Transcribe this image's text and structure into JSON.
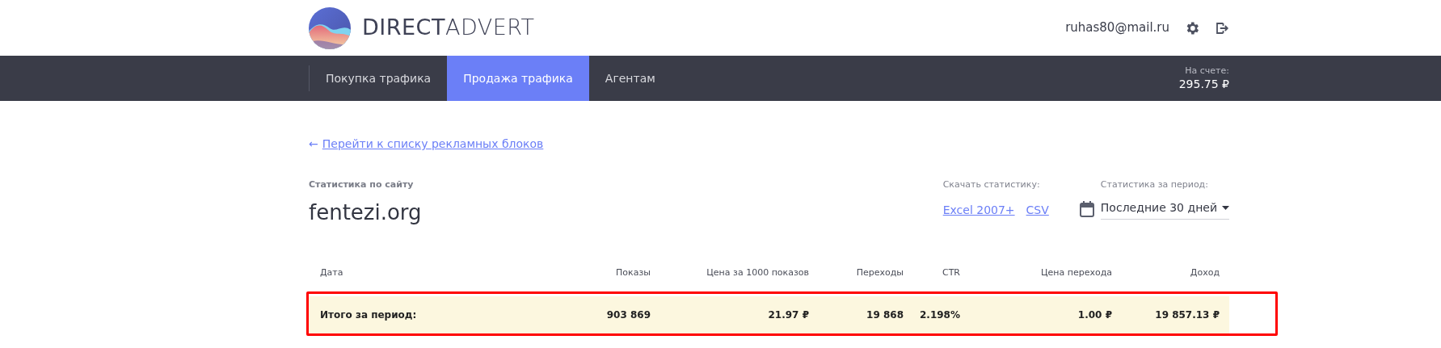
{
  "header": {
    "logo_text": "**DIRECT**ADVERT",
    "user_email": "ruhas80@mail.ru"
  },
  "nav": {
    "tabs": [
      {
        "label": "Покупка трафика",
        "selected": false
      },
      {
        "label": "Продажа трафика",
        "selected": true
      },
      {
        "label": "Агентам",
        "selected": false
      }
    ],
    "balance": {
      "label": "На счете:",
      "value": "295.75 ₽"
    }
  },
  "back_link": {
    "arrow": "←",
    "label": "Перейти к списку рекламных блоков"
  },
  "site": {
    "caption": "Статистика по сайту",
    "name": "fentezi.org"
  },
  "download": {
    "label": "Скачать статистику:",
    "links": [
      "Excel 2007+",
      "CSV"
    ]
  },
  "period": {
    "label": "Статистика за период:",
    "value": "Последние 30 дней"
  },
  "table": {
    "columns": [
      "Дата",
      "Показы",
      "Цена за 1000 показов",
      "Переходы",
      "CTR",
      "Цена перехода",
      "Доход"
    ],
    "total_row": {
      "highlighted": true,
      "cells": [
        "Итого за период:",
        "903 869",
        "21.97 ₽",
        "19 868",
        "2.198%",
        "1.00 ₽",
        "19 857.13 ₽"
      ]
    }
  }
}
